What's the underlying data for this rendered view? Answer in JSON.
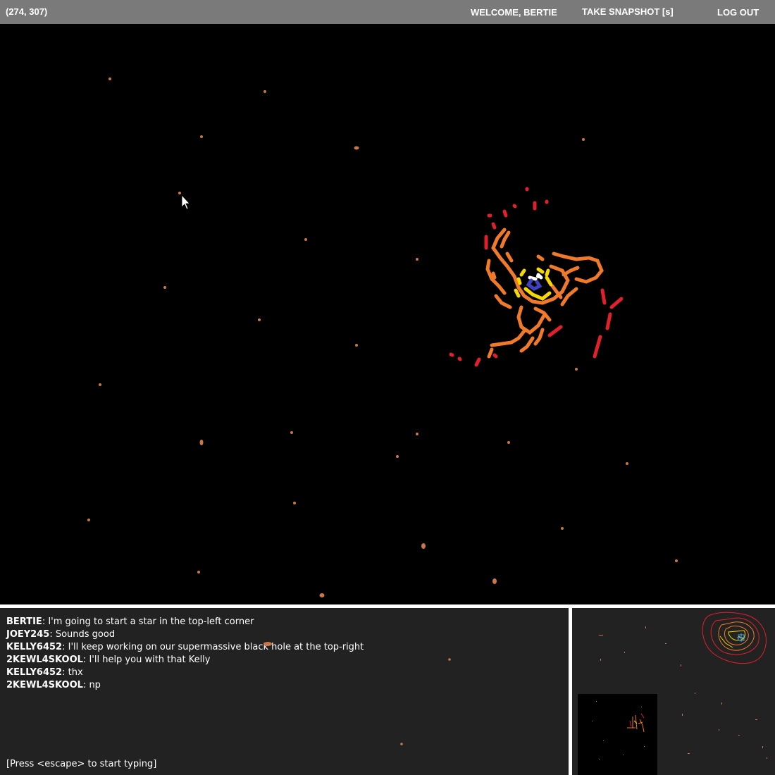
{
  "header": {
    "coordinates": "(274, 307)",
    "welcome": "WELCOME, BERTIE",
    "snapshot_label": "TAKE SNAPSHOT [s]",
    "logout_label": "LOG OUT"
  },
  "chat": {
    "messages": [
      {
        "author": "BERTIE",
        "text": "I'm going to start a star in the top-left corner"
      },
      {
        "author": "JOEY245",
        "text": "Sounds good"
      },
      {
        "author": "KELLY6452",
        "text": "I'll keep working on our supermassive black hole at the top-right"
      },
      {
        "author": "2KEWL4SKOOL",
        "text": "I'll help you with that Kelly"
      },
      {
        "author": "KELLY6452",
        "text": "thx"
      },
      {
        "author": "2KEWL4SKOOL",
        "text": "np"
      }
    ],
    "prompt": "[Press <escape> to start typing]"
  },
  "colors": {
    "topbar": "#7a7a7a",
    "canvas": "#000000",
    "panel": "#222222",
    "star_dust": "#c8764a",
    "red": "#e0202a",
    "orange": "#f07a2a",
    "yellow": "#f5d800",
    "blue": "#4040c0"
  },
  "icons": {
    "cursor": "mouse-pointer-icon"
  }
}
